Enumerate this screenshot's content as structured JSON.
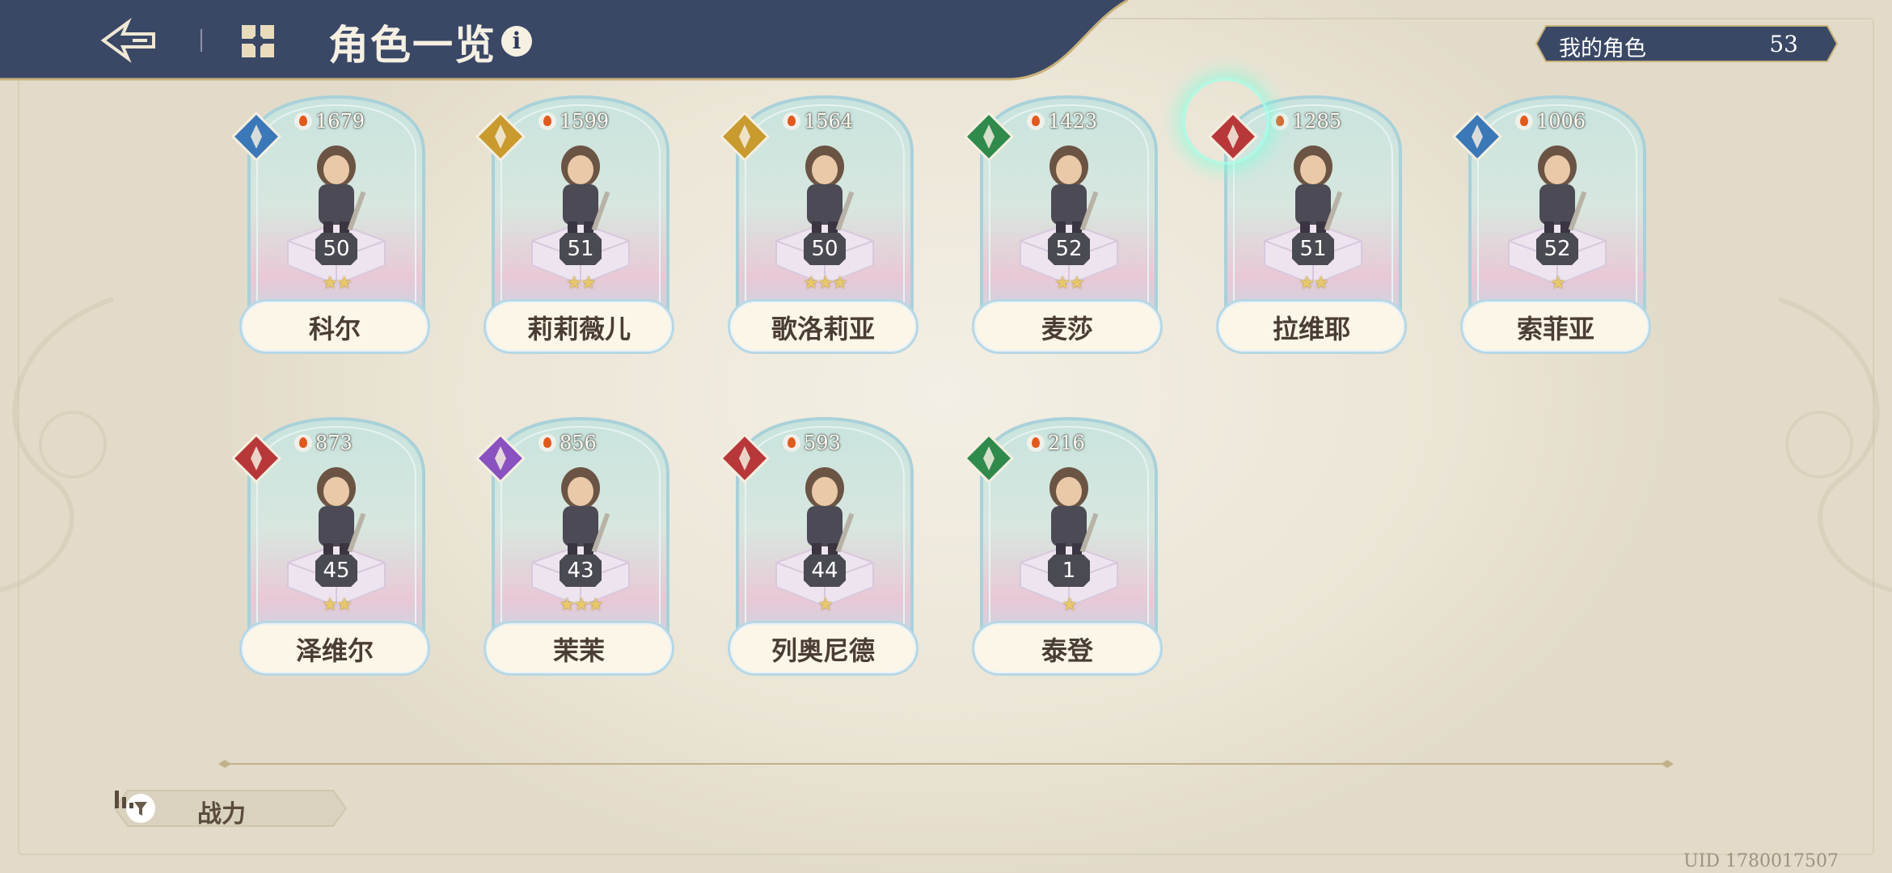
{
  "header": {
    "title": "角色一览",
    "info_glyph": "i",
    "icons": [
      "back-arrow-icon",
      "grid-icon",
      "info-icon"
    ]
  },
  "owned": {
    "label": "我的角色",
    "count": "53"
  },
  "characters": [
    {
      "name": "科尔",
      "power": "1679",
      "level": "50",
      "stars": 2,
      "element": "blue-wind",
      "element_color": "#3a78b8"
    },
    {
      "name": "莉莉薇儿",
      "power": "1599",
      "level": "51",
      "stars": 2,
      "element": "gold-light",
      "element_color": "#c99a2e"
    },
    {
      "name": "歌洛莉亚",
      "power": "1564",
      "level": "50",
      "stars": 3,
      "element": "gold-light",
      "element_color": "#c99a2e"
    },
    {
      "name": "麦莎",
      "power": "1423",
      "level": "52",
      "stars": 2,
      "element": "green-earth",
      "element_color": "#2f8a4c"
    },
    {
      "name": "拉维耶",
      "power": "1285",
      "level": "51",
      "stars": 2,
      "element": "red-fire",
      "element_color": "#b8383a"
    },
    {
      "name": "索菲亚",
      "power": "1006",
      "level": "52",
      "stars": 1,
      "element": "blue-wind",
      "element_color": "#3a78b8"
    },
    {
      "name": "泽维尔",
      "power": "873",
      "level": "45",
      "stars": 2,
      "element": "red-fire",
      "element_color": "#b8383a"
    },
    {
      "name": "茉茉",
      "power": "856",
      "level": "43",
      "stars": 3,
      "element": "purple-dark",
      "element_color": "#8a52c0"
    },
    {
      "name": "列奥尼德",
      "power": "593",
      "level": "44",
      "stars": 1,
      "element": "red-fire",
      "element_color": "#b8383a"
    },
    {
      "name": "泰登",
      "power": "216",
      "level": "1",
      "stars": 1,
      "element": "green-earth",
      "element_color": "#2f8a4c"
    }
  ],
  "sort": {
    "label": "战力"
  },
  "uid": "UID 1780017507",
  "colors": {
    "topbar": "#3a4866",
    "accent_blue": "#b8d7e4",
    "namebar": "#fbf6e8"
  }
}
